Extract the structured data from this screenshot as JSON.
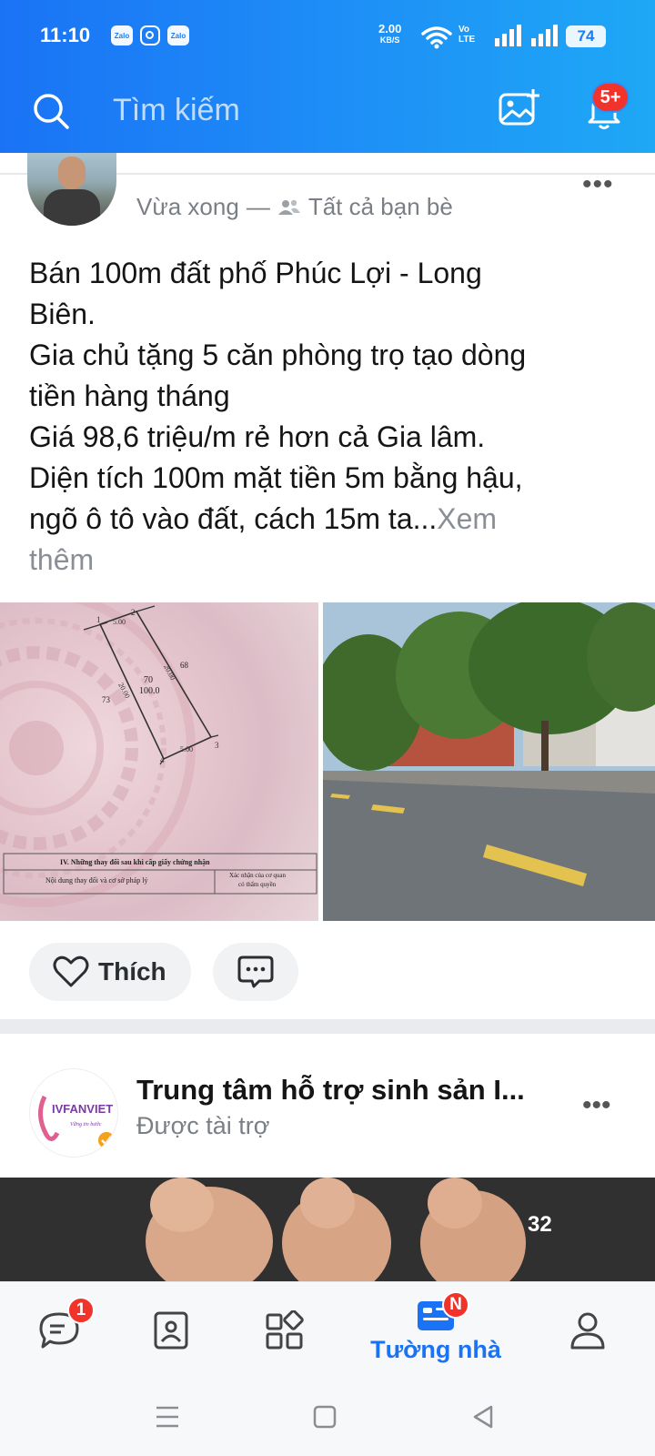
{
  "status_bar": {
    "time": "11:10",
    "app_icons": [
      "Zalo",
      "instagram-icon",
      "Zalo"
    ],
    "net_speed": "2.00",
    "net_speed_unit": "KB/S",
    "lte_label_top": "Vo",
    "lte_label_bottom": "LTE",
    "battery": "74"
  },
  "header": {
    "search_placeholder": "Tìm kiếm",
    "notification_badge": "5+",
    "accent_color": "#1a73f5"
  },
  "post": {
    "timestamp": "Vừa xong",
    "meta_separator": "—",
    "audience": "Tất cả bạn bè",
    "text_lines": [
      "Bán 100m đất phố Phúc Lợi - Long",
      "Biên.",
      "Gia chủ tặng 5 căn phòng trọ tạo dòng",
      "tiền hàng tháng",
      "Giá 98,6 triệu/m rẻ hơn cả Gia lâm.",
      "Diện tích 100m mặt tiền 5m bằng hậu,",
      "ngõ ô tô vào đất, cách 15m ta..."
    ],
    "see_more_1": "Xem",
    "see_more_2": "thêm",
    "more_icon": "more-dots-icon",
    "map_doc": {
      "plot_number": "70",
      "plot_area": "100.0",
      "neighbor_left": "73",
      "neighbor_right": "68",
      "point_labels": [
        "1",
        "2",
        "3",
        "4"
      ],
      "edge_top": "5.00",
      "edge_bottom": "5.00",
      "edge_side_left": "20.00",
      "edge_side_right": "20.00",
      "table_title": "IV. Những thay đổi sau khi cấp giấy chứng nhận",
      "table_col1": "Nội dung thay đổi và cơ sở pháp lý",
      "table_col2_line1": "Xác nhận của cơ quan",
      "table_col2_line2": "có thẩm quyền"
    },
    "like_label": "Thích"
  },
  "ad": {
    "title": "Trung tâm hỗ trợ sinh sản I...",
    "subtitle": "Được tài trợ",
    "logo_text": "IVFANVIET",
    "logo_tagline": "Vững tin bước",
    "image_count": "32"
  },
  "bottom_nav": {
    "messages_badge": "1",
    "timeline_badge": "N",
    "timeline_label": "Tường nhà"
  }
}
